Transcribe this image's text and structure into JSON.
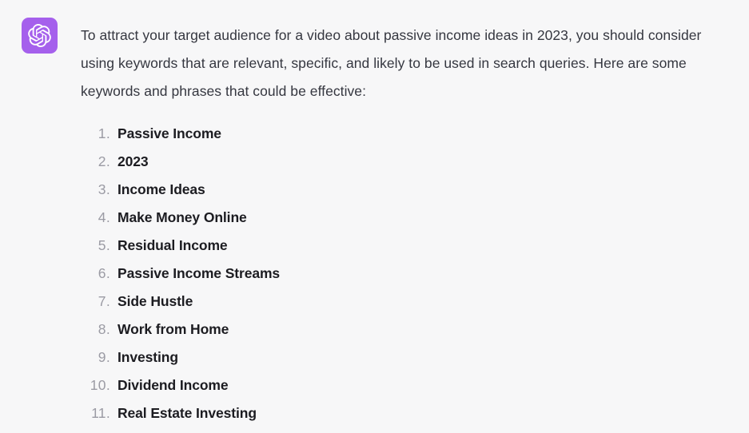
{
  "message": {
    "avatar_icon": "openai-logo-icon",
    "avatar_color": "#a560ec",
    "paragraph": "To attract your target audience for a video about passive income ideas in 2023, you should consider using keywords that are relevant, specific, and likely to be used in search queries. Here are some keywords and phrases that could be effective:",
    "list": [
      {
        "number": "1.",
        "label": "Passive Income"
      },
      {
        "number": "2.",
        "label": "2023"
      },
      {
        "number": "3.",
        "label": "Income Ideas"
      },
      {
        "number": "4.",
        "label": "Make Money Online"
      },
      {
        "number": "5.",
        "label": "Residual Income"
      },
      {
        "number": "6.",
        "label": "Passive Income Streams"
      },
      {
        "number": "7.",
        "label": "Side Hustle"
      },
      {
        "number": "8.",
        "label": "Work from Home"
      },
      {
        "number": "9.",
        "label": "Investing"
      },
      {
        "number": "10.",
        "label": "Dividend Income"
      },
      {
        "number": "11.",
        "label": "Real Estate Investing"
      }
    ]
  },
  "colors": {
    "background": "#f7f7f8",
    "body_text": "#353740",
    "list_text": "#1c1c21",
    "list_number": "#9b9ba4",
    "accent": "#a560ec"
  }
}
